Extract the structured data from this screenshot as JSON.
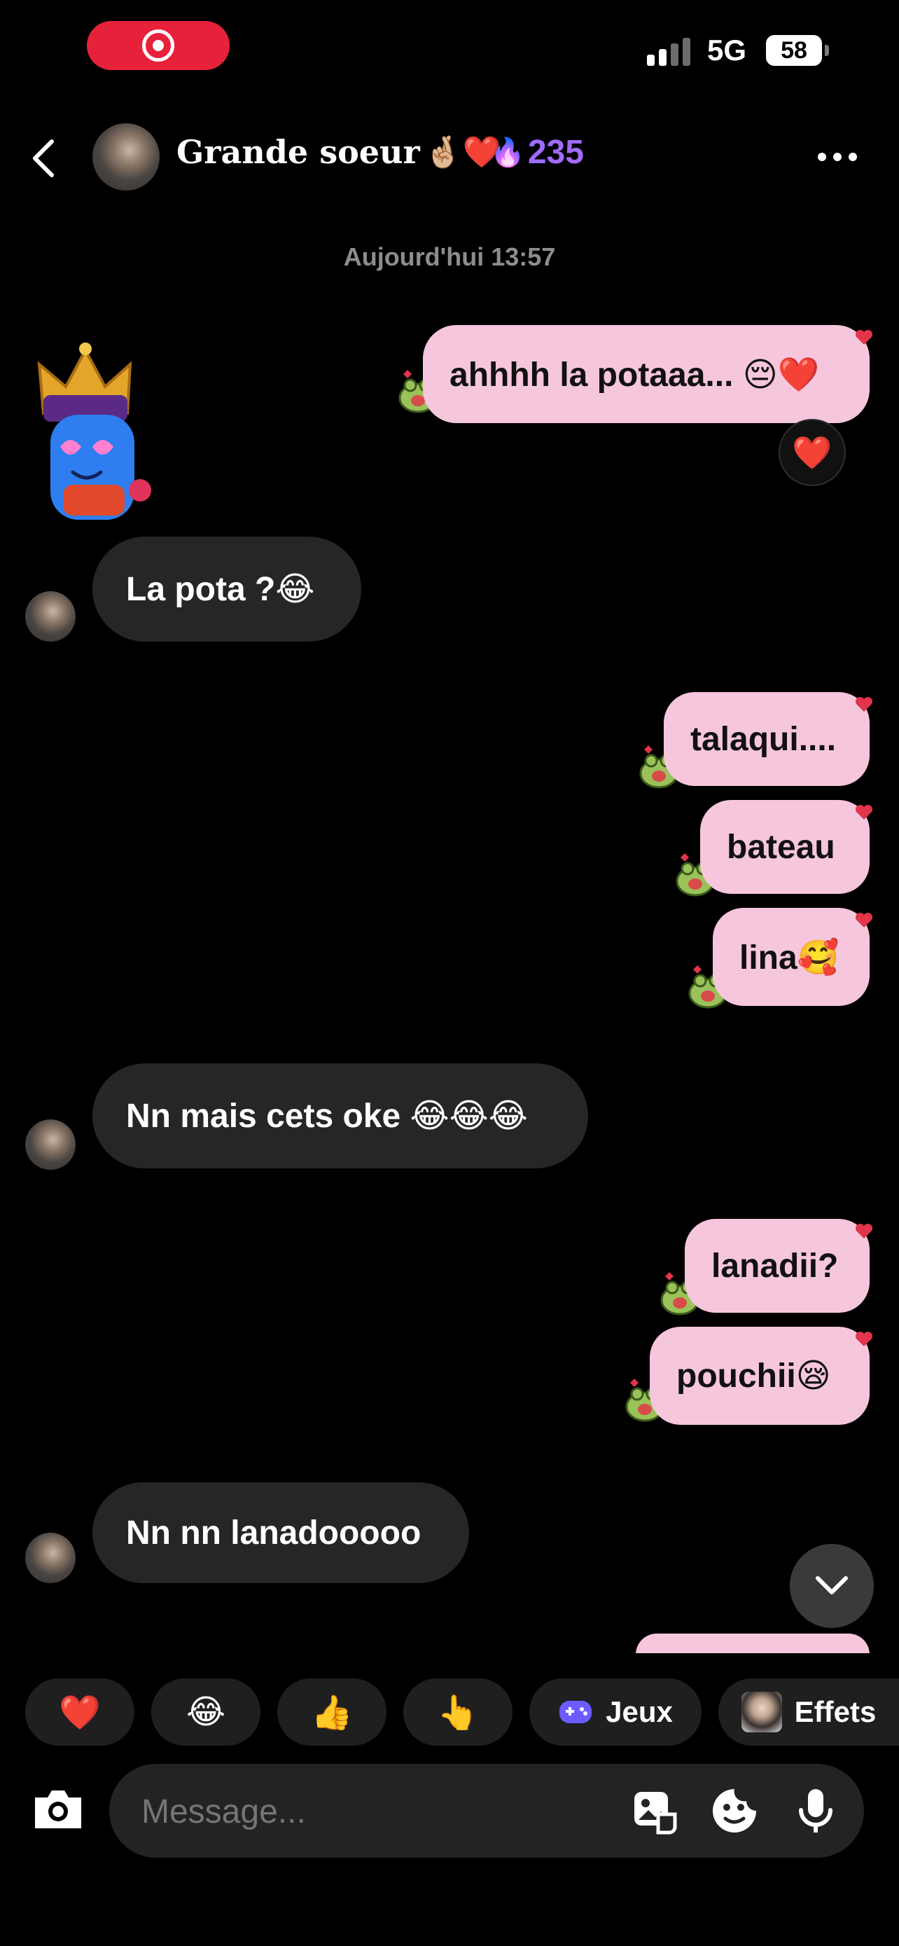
{
  "status_bar": {
    "network": "5G",
    "battery": "58"
  },
  "header": {
    "contact_name": "Grande soeur",
    "name_emojis": "🤞🏼❤️",
    "streak_icon": "🔥",
    "streak_count": "235"
  },
  "date_stamp": "Aujourd'hui 13:57",
  "messages": [
    {
      "side": "out",
      "text": "ahhhh la potaaa... 😔❤️",
      "reaction": "❤️"
    },
    {
      "side": "in",
      "text": "La pota ?😂"
    },
    {
      "side": "out",
      "text": "talaqui...."
    },
    {
      "side": "out",
      "text": "bateau"
    },
    {
      "side": "out",
      "text": "lina🥰"
    },
    {
      "side": "in",
      "text": "Nn mais cets oke 😂😂😂"
    },
    {
      "side": "out",
      "text": "lanadii?"
    },
    {
      "side": "out",
      "text": "pouchii😪"
    },
    {
      "side": "in",
      "text": "Nn nn lanadooooo"
    }
  ],
  "quick_actions": [
    {
      "icon": "❤️"
    },
    {
      "icon": "😂"
    },
    {
      "icon": "👍"
    },
    {
      "icon": "👆"
    },
    {
      "icon": "gamepad-icon",
      "label": "Jeux"
    },
    {
      "icon": "avatar-icon",
      "label": "Effets"
    }
  ],
  "composer": {
    "placeholder": "Message..."
  },
  "colors": {
    "outgoing_bubble": "#f6c6dd",
    "incoming_bubble": "#262626",
    "streak": "#a06bff",
    "record_pill": "#e8213b"
  }
}
